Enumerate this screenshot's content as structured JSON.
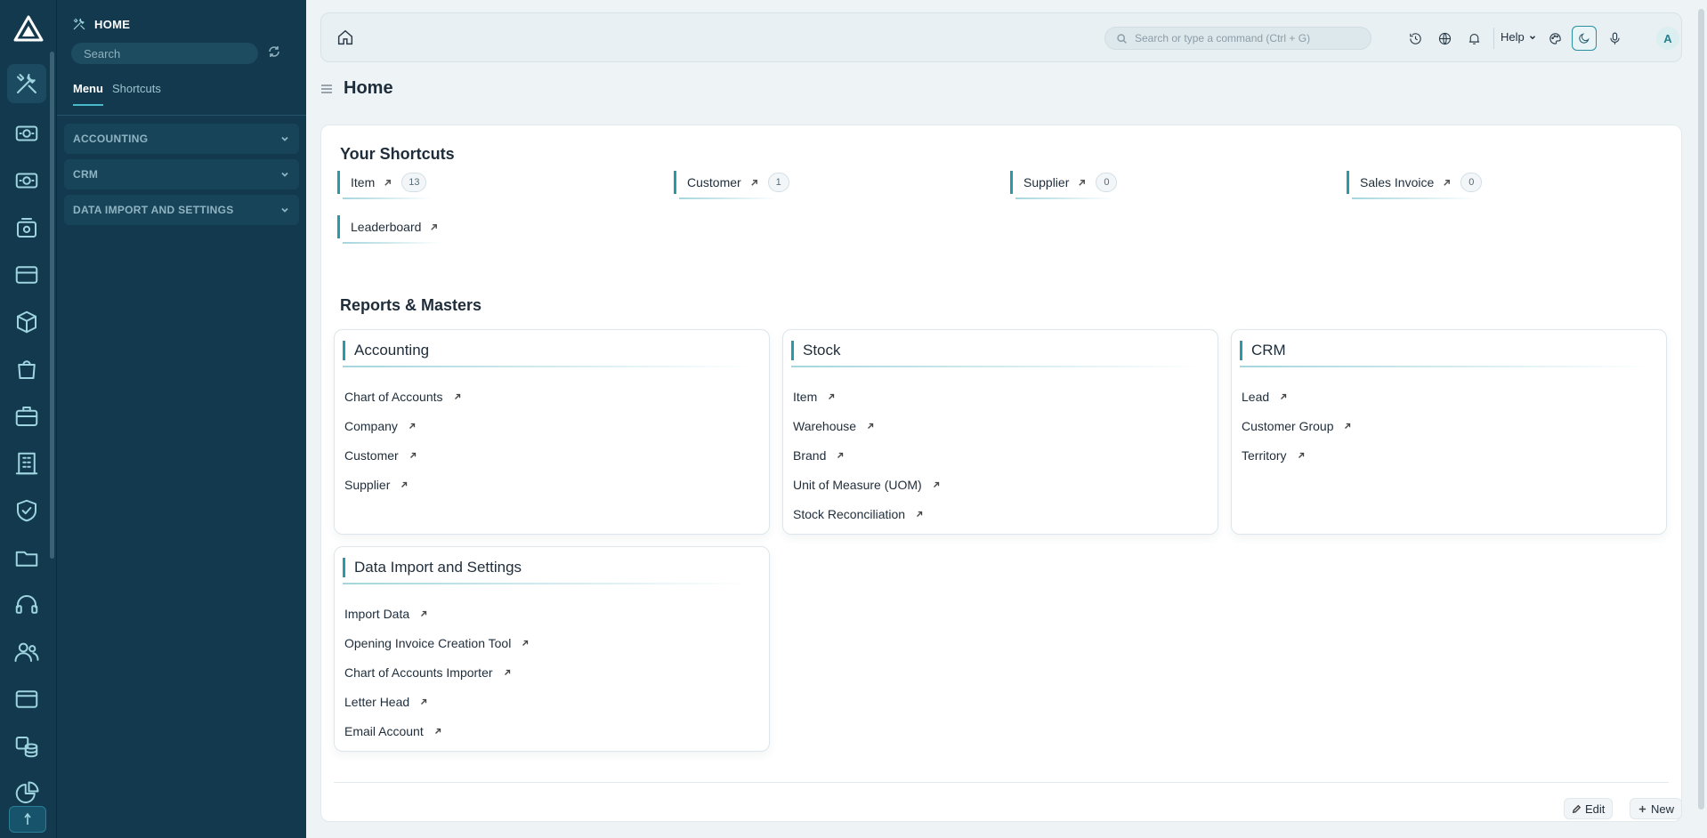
{
  "sidebar": {
    "title": "HOME",
    "search_placeholder": "Search",
    "tabs": [
      {
        "label": "Menu"
      },
      {
        "label": "Shortcuts"
      }
    ],
    "groups": [
      {
        "label": "ACCOUNTING"
      },
      {
        "label": "CRM"
      },
      {
        "label": "DATA IMPORT AND SETTINGS"
      }
    ]
  },
  "rail": {
    "icons": [
      "home-tools-icon",
      "money-eye-icon",
      "money-eye-icon",
      "cash-register-icon",
      "card-icon",
      "box-icon",
      "shopping-bag-icon",
      "briefcase-icon",
      "building-icon",
      "shield-check-icon",
      "folder-icon",
      "headset-icon",
      "users-icon",
      "browser-window-icon",
      "database-icon",
      "chart-pie-icon"
    ]
  },
  "topbar": {
    "search_placeholder": "Search or type a command (Ctrl + G)",
    "help_label": "Help",
    "avatar_letter": "A"
  },
  "page": {
    "title": "Home"
  },
  "shortcuts": {
    "title": "Your Shortcuts",
    "items": [
      {
        "label": "Item",
        "count": "13"
      },
      {
        "label": "Customer",
        "count": "1"
      },
      {
        "label": "Supplier",
        "count": "0"
      },
      {
        "label": "Sales Invoice",
        "count": "0"
      },
      {
        "label": "Leaderboard"
      }
    ]
  },
  "reports": {
    "title": "Reports & Masters",
    "cards": [
      {
        "title": "Accounting",
        "links": [
          "Chart of Accounts",
          "Company",
          "Customer",
          "Supplier"
        ]
      },
      {
        "title": "Stock",
        "links": [
          "Item",
          "Warehouse",
          "Brand",
          "Unit of Measure (UOM)",
          "Stock Reconciliation"
        ]
      },
      {
        "title": "CRM",
        "links": [
          "Lead",
          "Customer Group",
          "Territory"
        ]
      },
      {
        "title": "Data Import and Settings",
        "links": [
          "Import Data",
          "Opening Invoice Creation Tool",
          "Chart of Accounts Importer",
          "Letter Head",
          "Email Account"
        ]
      }
    ]
  },
  "footer": {
    "edit_label": "Edit",
    "new_label": "New"
  },
  "colors": {
    "sidebar_bg": "#12394d",
    "accent": "#2a9aa8"
  }
}
